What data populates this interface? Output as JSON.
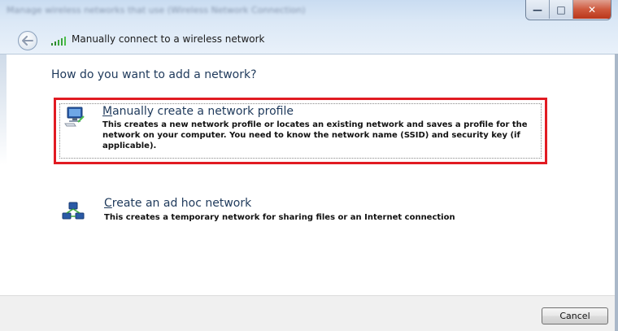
{
  "window": {
    "ghost_title": "Manage wireless networks that use (Wireless Network Connection)",
    "controls": {
      "minimize_glyph": "—",
      "maximize_glyph": "□",
      "close_glyph": "✕"
    }
  },
  "header": {
    "wizard_title": "Manually connect to a wireless network",
    "back_icon": "back-arrow-icon",
    "signal_icon": "wireless-signal-icon"
  },
  "main": {
    "question": "How do you want to add a network?",
    "options": [
      {
        "title_accel": "M",
        "title_rest": "anually create a network profile",
        "description": "This creates a new network profile or locates an existing network and saves a profile for the network on your computer. You need to know the network name (SSID) and security key (if applicable).",
        "icon": "network-profile-icon",
        "highlighted": true
      },
      {
        "title_accel": "C",
        "title_rest": "reate an ad hoc network",
        "description": "This creates a temporary network for sharing files or an Internet connection",
        "icon": "ad-hoc-network-icon",
        "highlighted": false
      }
    ]
  },
  "footer": {
    "cancel_label": "Cancel"
  },
  "colors": {
    "highlight_border": "#e11b22",
    "heading_blue": "#1e395b",
    "close_button_red": "#c8452a"
  }
}
